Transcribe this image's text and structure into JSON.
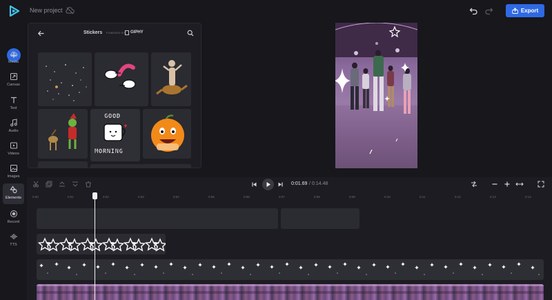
{
  "header": {
    "project_name": "New project",
    "export_label": "Export"
  },
  "sidebar": {
    "items": [
      {
        "label": "Media",
        "icon": "upload-cloud-icon"
      },
      {
        "label": "Canvas",
        "icon": "canvas-resize-icon"
      },
      {
        "label": "Text",
        "icon": "text-icon"
      },
      {
        "label": "Audio",
        "icon": "music-note-icon"
      },
      {
        "label": "Videos",
        "icon": "video-play-icon"
      },
      {
        "label": "Images",
        "icon": "image-icon"
      },
      {
        "label": "Elements",
        "icon": "shapes-icon"
      },
      {
        "label": "Record",
        "icon": "record-icon"
      },
      {
        "label": "TTS",
        "icon": "waveform-icon"
      }
    ],
    "active": "Elements"
  },
  "stickers_panel": {
    "title": "Stickers",
    "powered_by": "POWERED BY",
    "provider": "GIPHY",
    "stickers": [
      {
        "text_top": "",
        "text_bottom": ""
      },
      {
        "text_top": "",
        "text_bottom": ""
      },
      {
        "text_top": "",
        "text_bottom": ""
      },
      {
        "text_top": "",
        "text_bottom": ""
      },
      {
        "text_top": "GOOD",
        "text_bottom": "MORNING"
      },
      {
        "text_top": "",
        "text_bottom": ""
      }
    ]
  },
  "playback": {
    "current_time": "0:01.69",
    "total_time": "/ 0:14.48"
  },
  "ruler": {
    "labels": [
      "0:00",
      "0:01",
      "0:02",
      "0:03",
      "0:04",
      "0:05",
      "0:06",
      "0:07",
      "0:08",
      "0:09",
      "0:10",
      "0:11",
      "0:12",
      "0:13",
      "0:14"
    ]
  },
  "colors": {
    "accent": "#2f6ae3",
    "background": "#17171c",
    "panel": "#1d1d23",
    "track": "#2b2b32"
  }
}
